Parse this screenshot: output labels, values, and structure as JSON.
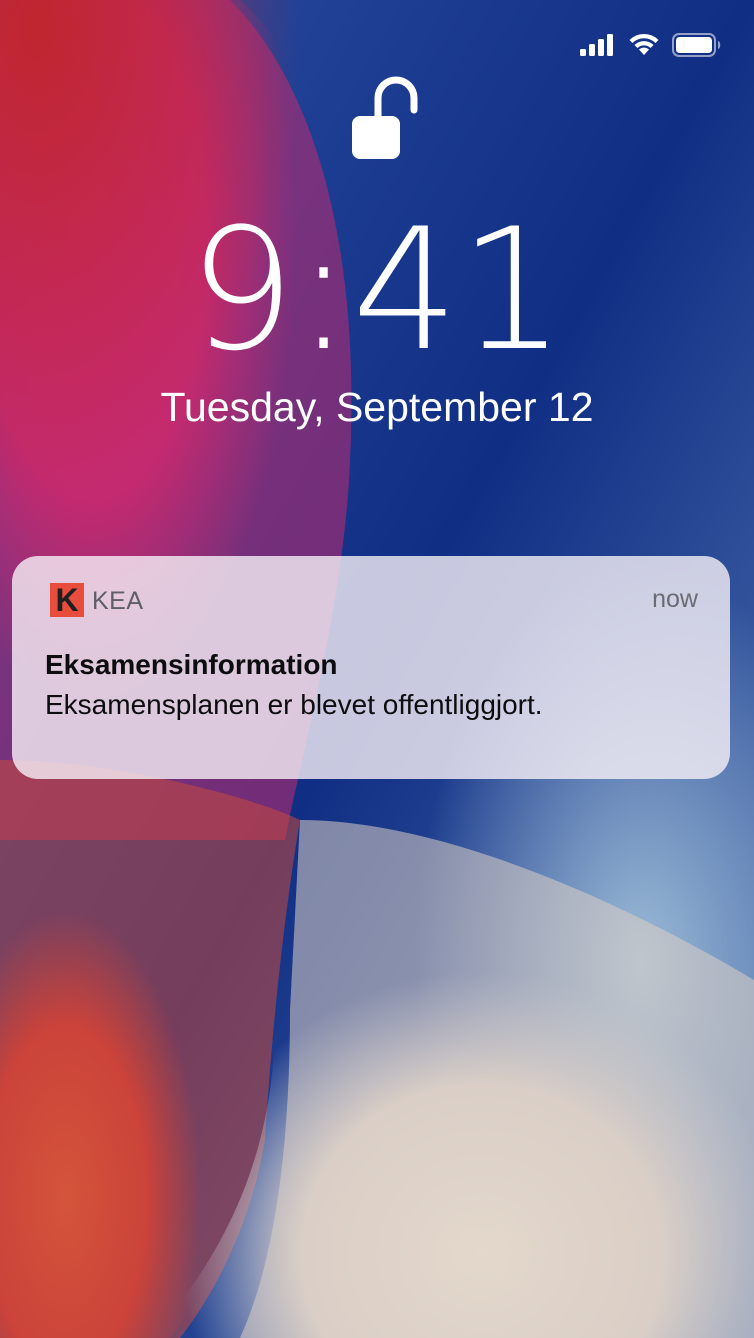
{
  "lock_screen": {
    "time": "9:41",
    "date": "Tuesday, September 12",
    "lock_state": "unlocked"
  },
  "status_bar": {
    "cellular_icon": "cellular-signal-icon",
    "wifi_icon": "wifi-icon",
    "battery_icon": "battery-icon",
    "battery_level": 1.0
  },
  "notification": {
    "app_name": "KEA",
    "app_icon_letter": "K",
    "app_icon_color": "#e84c3d",
    "time": "now",
    "title": "Eksamensinformation",
    "body": "Eksamensplanen er blevet offentliggjort."
  },
  "colors": {
    "wallpaper_blue": "#1b3c8c",
    "wallpaper_pink": "#c5286f",
    "wallpaper_red": "#d23a2c",
    "text_white": "#ffffff"
  }
}
